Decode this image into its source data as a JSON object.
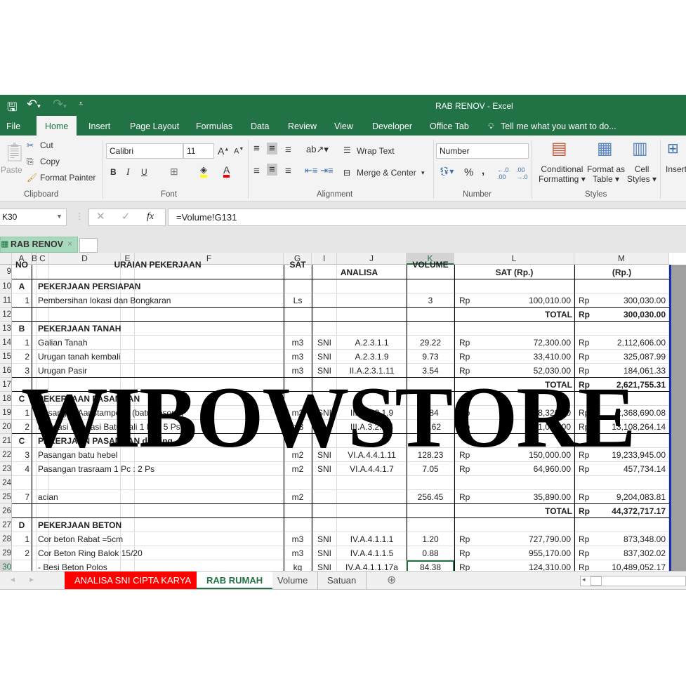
{
  "app": {
    "title": "RAB RENOV - Excel",
    "accent": "#217346"
  },
  "qat": {
    "save_icon": "save-icon",
    "undo_icon": "undo-icon",
    "redo_icon": "redo-icon"
  },
  "menu": {
    "tabs": [
      "File",
      "Home",
      "Insert",
      "Page Layout",
      "Formulas",
      "Data",
      "Review",
      "View",
      "Developer",
      "Office Tab"
    ],
    "active": "Home",
    "tell_me": "Tell me what you want to do..."
  },
  "ribbon": {
    "clipboard": {
      "paste": "Paste",
      "cut": "Cut",
      "copy": "Copy",
      "format_painter": "Format Painter",
      "label": "Clipboard"
    },
    "font": {
      "name": "Calibri",
      "size": "11",
      "bold": "B",
      "italic": "I",
      "underline": "U",
      "label": "Font",
      "fill_color": "#ffff00",
      "font_color": "#ff0000"
    },
    "alignment": {
      "wrap_text": "Wrap Text",
      "merge_center": "Merge & Center",
      "label": "Alignment"
    },
    "number": {
      "format": "Number",
      "percent": "%",
      "comma": ",",
      "label": "Number"
    },
    "styles": {
      "conditional": "Conditional",
      "formatting": "Formatting",
      "format_as": "Format as",
      "table": "Table",
      "cell": "Cell",
      "cell_styles": "Styles",
      "label": "Styles"
    },
    "cells": {
      "insert": "Insert"
    }
  },
  "formula_bar": {
    "name_box": "K30",
    "fx": "fx",
    "formula": "=Volume!G131"
  },
  "doc_tab": {
    "label": "RAB RENOV",
    "close": "×"
  },
  "columns": [
    "A",
    "B",
    "C",
    "D",
    "E",
    "F",
    "G",
    "I",
    "J",
    "K",
    "L",
    "M"
  ],
  "header_row": {
    "no": "NO",
    "uraian": "URAIAN PEKERJAAN",
    "sat": "SAT",
    "analisa": "ANALISA",
    "volume": "VOLUME",
    "harga_sat": "SAT (Rp.)",
    "jumlah": "(Rp.)"
  },
  "rows": [
    {
      "n": "9",
      "type": "header"
    },
    {
      "n": "10",
      "type": "section",
      "no": "A",
      "desc": "PEKERJAAN PERSIAPAN"
    },
    {
      "n": "11",
      "no": "1",
      "desc": "Pembersihan lokasi dan Bongkaran",
      "sat": "Ls",
      "sni": "",
      "analisa": "",
      "vol": "3",
      "rp1": "Rp",
      "price": "100,010.00",
      "rp2": "Rp",
      "total": "300,030.00"
    },
    {
      "n": "12",
      "type": "total",
      "label": "TOTAL",
      "rp2": "Rp",
      "total": "300,030.00"
    },
    {
      "n": "13",
      "type": "section",
      "no": "B",
      "desc": "PEKERJAAN TANAH"
    },
    {
      "n": "14",
      "no": "1",
      "desc": "Galian Tanah",
      "sat": "m3",
      "sni": "SNI",
      "analisa": "A.2.3.1.1",
      "vol": "29.22",
      "rp1": "Rp",
      "price": "72,300.00",
      "rp2": "Rp",
      "total": "2,112,606.00"
    },
    {
      "n": "15",
      "no": "2",
      "desc": "Urugan tanah kembali",
      "sat": "m3",
      "sni": "SNI",
      "analisa": "A.2.3.1.9",
      "vol": "9.73",
      "rp1": "Rp",
      "price": "33,410.00",
      "rp2": "Rp",
      "total": "325,087.99"
    },
    {
      "n": "16",
      "no": "3",
      "desc": "Urugan Pasir",
      "sat": "m3",
      "sni": "SNI",
      "analisa": "II.A.2.3.1.11",
      "vol": "3.54",
      "rp1": "Rp",
      "price": "52,030.00",
      "rp2": "Rp",
      "total": "184,061.33"
    },
    {
      "n": "17",
      "type": "total",
      "label": "TOTAL",
      "rp2": "Rp",
      "total": "2,621,755.31"
    },
    {
      "n": "18",
      "type": "section",
      "no": "C",
      "desc": "PEKERJAAN PASANGAN"
    },
    {
      "n": "19",
      "no": "1",
      "desc": "Pasangan Aanstampeng (batu kosong)",
      "sat": "m3",
      "sni": "SNI",
      "analisa": "III.A.3.2.1.9",
      "vol": "8.84",
      "rp1": "Rp",
      "price": "268,320.00",
      "rp2": "Rp",
      "total": "2,368,690.08"
    },
    {
      "n": "20",
      "no": "2",
      "desc": "Pondasi Pondasi Batu Kali 1 Pc : 5 Ps",
      "sat": "m3",
      "sni": "SNI",
      "analisa": "III.A.3.2.1.4",
      "vol": "12.62",
      "rp1": "Rp",
      "price": "721,070.00",
      "rp2": "Rp",
      "total": "13,108,264.14"
    },
    {
      "n": "21",
      "type": "section",
      "no": "C",
      "desc": "PEKERJAAN PASANGAN dinding"
    },
    {
      "n": "22",
      "no": "3",
      "desc": "Pasangan batu hebel",
      "sat": "m2",
      "sni": "SNI",
      "analisa": "VI.A.4.4.1.11",
      "vol": "128.23",
      "rp1": "Rp",
      "price": "150,000.00",
      "rp2": "Rp",
      "total": "19,233,945.00"
    },
    {
      "n": "23",
      "no": "4",
      "desc": "Pasangan trasraam 1 Pc : 2 Ps",
      "sat": "m2",
      "sni": "SNI",
      "analisa": "VI.A.4.4.1.7",
      "vol": "7.05",
      "rp1": "Rp",
      "price": "64,960.00",
      "rp2": "Rp",
      "total": "457,734.14"
    },
    {
      "n": "24",
      "type": "blank"
    },
    {
      "n": "25",
      "no": "7",
      "desc": "acian",
      "sat": "m2",
      "sni": "",
      "analisa": "",
      "vol": "256.45",
      "rp1": "Rp",
      "price": "35,890.00",
      "rp2": "Rp",
      "total": "9,204,083.81"
    },
    {
      "n": "26",
      "type": "total",
      "label": "TOTAL",
      "rp2": "Rp",
      "total": "44,372,717.17"
    },
    {
      "n": "27",
      "type": "section",
      "no": "D",
      "desc": "PEKERJAAN BETON"
    },
    {
      "n": "28",
      "no": "1",
      "desc": "Cor beton Rabat =5cm",
      "sat": "m3",
      "sni": "SNI",
      "analisa": "IV.A.4.1.1.1",
      "vol": "1.20",
      "rp1": "Rp",
      "price": "727,790.00",
      "rp2": "Rp",
      "total": "873,348.00"
    },
    {
      "n": "29",
      "no": "2",
      "desc": "Cor Beton Ring Balok  15/20",
      "sat": "m3",
      "sni": "SNI",
      "analisa": "IV.A.4.1.1.5",
      "vol": "0.88",
      "rp1": "Rp",
      "price": "955,170.00",
      "rp2": "Rp",
      "total": "837,302.02"
    },
    {
      "n": "30",
      "no": "",
      "desc": "- Besi Beton Polos",
      "sat": "kg",
      "sni": "SNI",
      "analisa": "IV.A.4.1.1.17a",
      "vol": "84.38",
      "rp1": "Rp",
      "price": "124,310.00",
      "rp2": "Rp",
      "total": "10,489,052.17"
    }
  ],
  "sheets": [
    {
      "label": "ANALISA SNI CIPTA KARYA",
      "color": "#ff0000"
    },
    {
      "label": "RAB RUMAH",
      "active": true
    },
    {
      "label": "Volume"
    },
    {
      "label": "Satuan"
    }
  ],
  "watermark": "WIBOWSTORE"
}
